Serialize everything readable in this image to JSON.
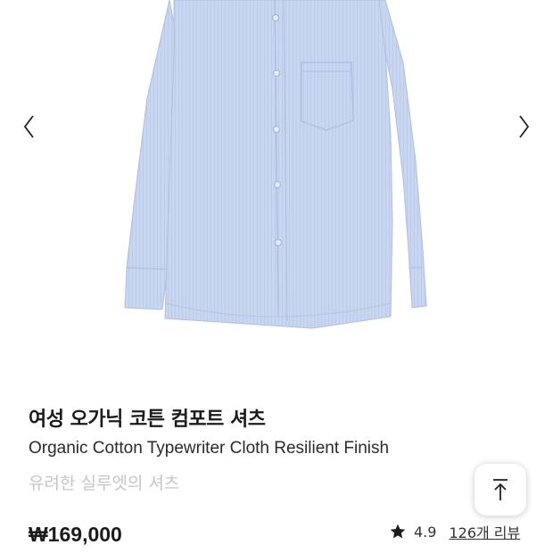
{
  "gallery": {
    "image_alt": "shirt-product-image",
    "prev_icon": "chevron-left-icon",
    "next_icon": "chevron-right-icon"
  },
  "product": {
    "title_ko": "여성 오가닉 코튼 컴포트 셔츠",
    "title_en": "Organic Cotton Typewriter Cloth Resilient Finish",
    "subtitle": "유려한 실루엣의 셔츠",
    "price": "₩169,000"
  },
  "rating": {
    "icon": "star-icon",
    "value": "4.9",
    "review_link": "126개 리뷰"
  },
  "scroll_top": {
    "icon": "arrow-up-icon"
  },
  "colors": {
    "shirt": "#c9d6ef",
    "text": "#1b1b1b",
    "muted": "#c6c6c6"
  }
}
